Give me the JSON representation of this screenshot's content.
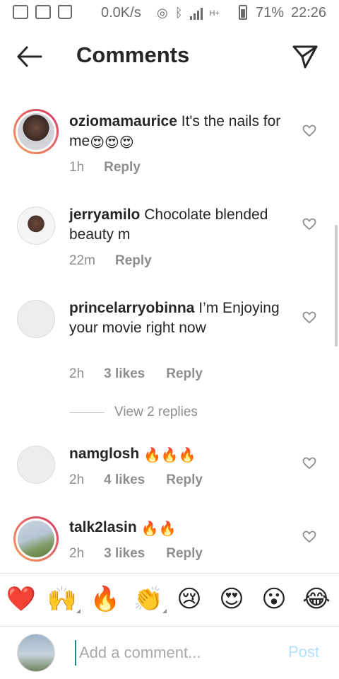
{
  "status_bar": {
    "speed": "0.0K/s",
    "battery": "71%",
    "time": "22:26",
    "network": "H+"
  },
  "header": {
    "title": "Comments"
  },
  "comments": [
    {
      "username": "oziomamaurice",
      "text": "It's the nails for me",
      "emoji": "😍😍😍",
      "time": "1h",
      "likes": "",
      "reply": "Reply"
    },
    {
      "username": "jerryamilo",
      "text": "Chocolate blended beauty m",
      "emoji": "",
      "time": "22m",
      "likes": "",
      "reply": "Reply"
    },
    {
      "username": "princelarryobinna",
      "text": "I’m Enjoying your movie right now",
      "emoji": "",
      "time": "2h",
      "likes": "3 likes",
      "reply": "Reply"
    },
    {
      "username": "namglosh",
      "text": "",
      "emoji": "🔥🔥🔥",
      "time": "2h",
      "likes": "4 likes",
      "reply": "Reply"
    },
    {
      "username": "talk2lasin",
      "text": "",
      "emoji": "🔥🔥",
      "time": "2h",
      "likes": "3 likes",
      "reply": "Reply"
    }
  ],
  "view_replies": "View 2 replies",
  "reactions": [
    "❤️",
    "🙌",
    "🔥",
    "👏",
    "😢",
    "😍",
    "😮",
    "😂"
  ],
  "composer": {
    "placeholder": "Add a comment...",
    "post_label": "Post"
  },
  "colors": {
    "story_ring_start": "#f2a25b",
    "story_ring_end": "#d8346a",
    "post_disabled": "#b2dffc",
    "meta_gray": "#8e8e8e"
  }
}
